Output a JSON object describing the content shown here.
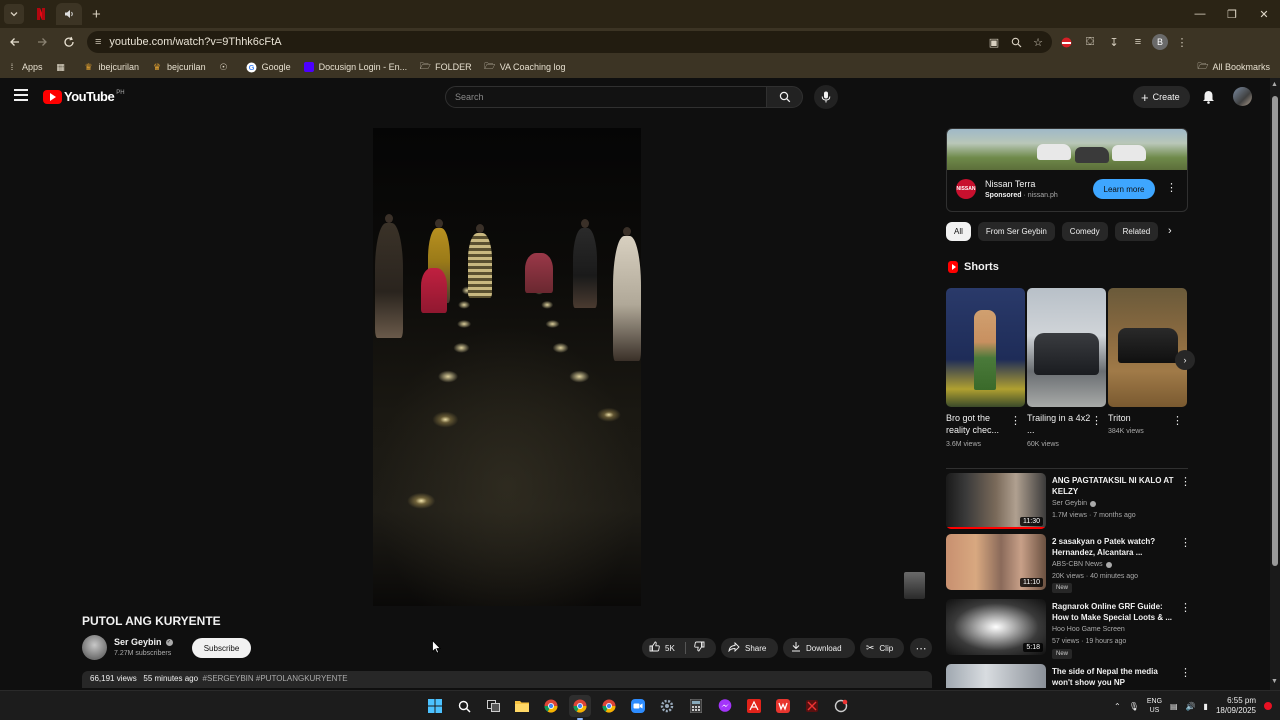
{
  "browser": {
    "url": "youtube.com/watch?v=9Thhk6cFtA",
    "bookmarks": [
      {
        "label": "Apps"
      },
      {
        "label": "ibejcurilan"
      },
      {
        "label": "bejcurilan"
      },
      {
        "label": ""
      },
      {
        "label": "Google"
      },
      {
        "label": "Docusign Login - En..."
      },
      {
        "label": "FOLDER"
      },
      {
        "label": "VA Coaching log"
      }
    ],
    "all_bookmarks": "All Bookmarks",
    "profile_initial": "B"
  },
  "yt": {
    "logo_text": "YouTube",
    "country": "PH",
    "search_placeholder": "Search",
    "create_label": "Create"
  },
  "video": {
    "title": "PUTOL ANG KURYENTE",
    "channel": "Ser Geybin",
    "subscribers": "7.27M subscribers",
    "subscribe_label": "Subscribe",
    "likes": "5K",
    "share_label": "Share",
    "download_label": "Download",
    "clip_label": "Clip",
    "views": "66,191 views",
    "age": "55 minutes ago",
    "tags": "#SERGEYBIN #PUTOLANGKURYENTE"
  },
  "ad": {
    "title": "Nissan Terra",
    "sponsored": "Sponsored",
    "domain": "nissan.ph",
    "cta": "Learn more",
    "logo_text": "NISSAN"
  },
  "chips": [
    "All",
    "From Ser Geybin",
    "Comedy",
    "Related"
  ],
  "shorts": {
    "heading": "Shorts",
    "items": [
      {
        "title": "Bro got the reality chec...",
        "views": "3.6M views"
      },
      {
        "title": "Trailing in a 4x2 ...",
        "views": "60K views"
      },
      {
        "title": "Triton",
        "views": "384K views"
      }
    ]
  },
  "recommendations": [
    {
      "title": "ANG PAGTATAKSIL NI KALO AT KELZY",
      "channel": "Ser Geybin",
      "verified": true,
      "meta": "1.7M views · 7 months ago",
      "duration": "11:30",
      "new": ""
    },
    {
      "title": "2 sasakyan o Patek watch? Hernandez, Alcantara ...",
      "channel": "ABS-CBN News",
      "verified": true,
      "meta": "20K views · 40 minutes ago",
      "duration": "11:10",
      "new": "New"
    },
    {
      "title": "Ragnarok Online GRF Guide: How to Make Special Loots & ...",
      "channel": "Hoo Hoo Game Screen",
      "verified": false,
      "meta": "57 views · 19 hours ago",
      "duration": "5:18",
      "new": "New"
    },
    {
      "title": "The side of Nepal the media won't show you NP",
      "channel": "",
      "verified": false,
      "meta": "",
      "duration": "",
      "new": ""
    }
  ],
  "taskbar": {
    "lang_top": "ENG",
    "lang_bottom": "US",
    "time": "6:55 pm",
    "date": "18/09/2025"
  },
  "colors": {
    "background": "#0f0f0f",
    "accent_red": "#ff0000",
    "learn_more_blue": "#3ea6ff",
    "browser_chrome": "#3c3424"
  }
}
